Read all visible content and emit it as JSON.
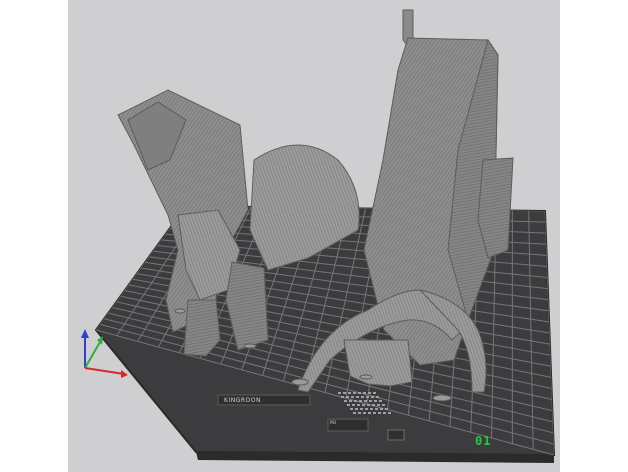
{
  "viewport": {
    "plate_id": "01",
    "logo_text": "KINGROON",
    "label_text": "PEI"
  },
  "colors": {
    "background": "#cfcfd1",
    "plate": "#3c3c3e",
    "grid": "#7a7a7c",
    "model": "#8f8f90",
    "axis_x": "#d22b2b",
    "axis_y": "#2fae3a",
    "axis_z": "#2a3fd6",
    "plate_id": "#27c93f"
  }
}
